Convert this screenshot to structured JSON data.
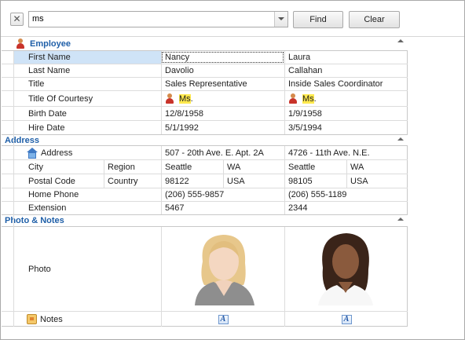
{
  "toolbar": {
    "close_glyph": "✕",
    "search_value": "ms",
    "find_label": "Find",
    "clear_label": "Clear"
  },
  "employee": {
    "section_title": "Employee",
    "rows": [
      {
        "label": "First Name",
        "values": [
          "Nancy",
          "Laura"
        ]
      },
      {
        "label": "Last Name",
        "values": [
          "Davolio",
          "Callahan"
        ]
      },
      {
        "label": "Title",
        "values": [
          "Sales Representative",
          "Inside Sales Coordinator"
        ]
      },
      {
        "label": "Title Of Courtesy",
        "values": [
          "Ms.",
          "Ms."
        ]
      },
      {
        "label": "Birth Date",
        "values": [
          "12/8/1958",
          "1/9/1958"
        ]
      },
      {
        "label": "Hire Date",
        "values": [
          "5/1/1992",
          "3/5/1994"
        ]
      }
    ],
    "highlight_term": "Ms",
    "highlight_rest": "."
  },
  "address": {
    "section_title": "Address",
    "address_label": "Address",
    "address_values": [
      "507 - 20th Ave. E. Apt. 2A",
      "4726 - 11th Ave. N.E."
    ],
    "city_label": "City",
    "region_label": "Region",
    "city_values": [
      "Seattle",
      "Seattle"
    ],
    "region_values": [
      "WA",
      "WA"
    ],
    "postal_label": "Postal Code",
    "country_label": "Country",
    "postal_values": [
      "98122",
      "98105"
    ],
    "country_values": [
      "USA",
      "USA"
    ],
    "home_phone_label": "Home Phone",
    "home_phone_values": [
      "(206) 555-9857",
      "(206) 555-1189"
    ],
    "extension_label": "Extension",
    "extension_values": [
      "5467",
      "2344"
    ]
  },
  "photo_notes": {
    "section_title": "Photo & Notes",
    "photo_label": "Photo",
    "notes_label": "Notes",
    "memo_glyph": "A"
  },
  "colors": {
    "section_header": "#1f5fa8",
    "selection": "#cfe3f7",
    "search_highlight": "#ffe94d"
  },
  "icons": [
    "close-icon",
    "dropdown-arrow-icon",
    "employee-icon",
    "address-icon",
    "notes-icon",
    "courtesy-icon",
    "memo-edit-icon",
    "collapse-icon"
  ]
}
